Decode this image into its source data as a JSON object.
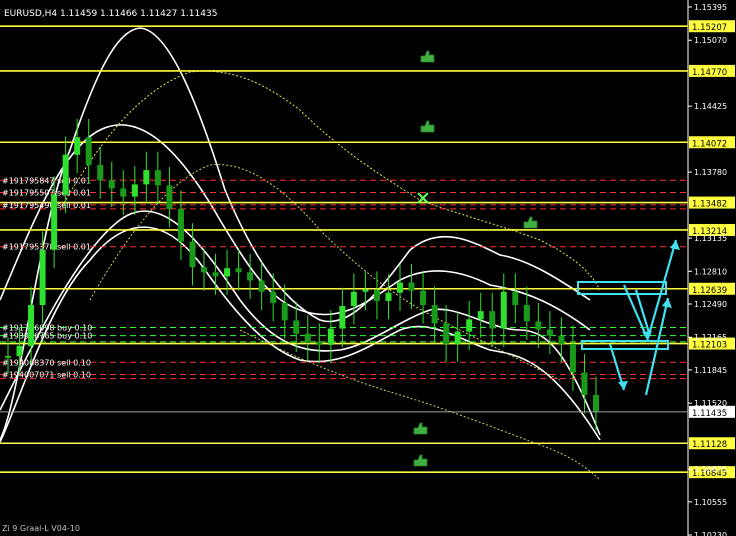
{
  "chart_data": {
    "type": "candlestick",
    "symbol_header": "EURUSD,H4  1.11459 1.11466 1.11427 1.11435",
    "indicator_label": "Zi 9 Graal-L  V04-10",
    "current_price": 1.11435,
    "current_price_label": "1.11435",
    "ylim": [
      1.1025,
      1.15395
    ],
    "y_ticks": [
      {
        "value": 1.15395,
        "label": "1.15395"
      },
      {
        "value": 1.1507,
        "label": "1.15070"
      },
      {
        "value": 1.14425,
        "label": "1.14425"
      },
      {
        "value": 1.1378,
        "label": "1.13780"
      },
      {
        "value": 1.13135,
        "label": "1.13135"
      },
      {
        "value": 1.1281,
        "label": "1.12810"
      },
      {
        "value": 1.1249,
        "label": "1.12490"
      },
      {
        "value": 1.12165,
        "label": "1.12165"
      },
      {
        "value": 1.11845,
        "label": "1.11845"
      },
      {
        "value": 1.1152,
        "label": "1.11520"
      },
      {
        "value": 1.10875,
        "label": "1.10875"
      },
      {
        "value": 1.10555,
        "label": "1.10555"
      },
      {
        "value": 1.1023,
        "label": "1.10230"
      }
    ],
    "level_lines": [
      {
        "value": 1.15207,
        "label": "1.15207"
      },
      {
        "value": 1.1477,
        "label": "1.14770"
      },
      {
        "value": 1.14072,
        "label": "1.14072"
      },
      {
        "value": 1.13482,
        "label": "1.13482"
      },
      {
        "value": 1.13214,
        "label": "1.13214"
      },
      {
        "value": 1.12639,
        "label": "1.12639"
      },
      {
        "value": 1.12103,
        "label": "1.12103"
      },
      {
        "value": 1.11128,
        "label": "1.11128"
      },
      {
        "value": 1.10845,
        "label": "1.10845"
      }
    ],
    "order_lines": [
      {
        "value": 1.137,
        "label": "#191795847 sell 0.01",
        "color": "#ff3030"
      },
      {
        "value": 1.1358,
        "label": "#191795507 sell 0.01",
        "color": "#ff3030"
      },
      {
        "value": 1.1346,
        "label": "#191795490 sell 0.01",
        "color": "#ff3030"
      },
      {
        "value": 1.1342,
        "label": "",
        "color": "#ff3030"
      },
      {
        "value": 1.1305,
        "label": "#191795378 sell 0.01",
        "color": "#ff3030"
      },
      {
        "value": 1.1226,
        "label": "#191756098 buy 0.10",
        "color": "#30ff30"
      },
      {
        "value": 1.1218,
        "label": "#193946765 buy 0.10",
        "color": "#30ff30"
      },
      {
        "value": 1.1212,
        "label": "",
        "color": "#30ff30"
      },
      {
        "value": 1.1192,
        "label": "#194068370 sell 0.10",
        "color": "#ff3030"
      },
      {
        "value": 1.118,
        "label": "#194007071 sell 0.10",
        "color": "#ff3030"
      },
      {
        "value": 1.1176,
        "label": "",
        "color": "#ff3030"
      }
    ],
    "candles_close_path": [
      1.1198,
      1.1208,
      1.1248,
      1.1302,
      1.1356,
      1.1395,
      1.1412,
      1.1385,
      1.137,
      1.1362,
      1.1354,
      1.1366,
      1.138,
      1.1365,
      1.1342,
      1.131,
      1.1285,
      1.128,
      1.1276,
      1.1284,
      1.128,
      1.1272,
      1.1261,
      1.125,
      1.1233,
      1.122,
      1.1212,
      1.1209,
      1.1225,
      1.1247,
      1.1261,
      1.1263,
      1.1252,
      1.126,
      1.127,
      1.1262,
      1.1248,
      1.123,
      1.121,
      1.1222,
      1.1234,
      1.1242,
      1.1225,
      1.1261,
      1.1248,
      1.1232,
      1.1224,
      1.1218,
      1.121,
      1.1182,
      1.116,
      1.11435
    ],
    "series_color": "#30e030",
    "level_line_color": "#ffff40",
    "band_color": "#ffffff",
    "ma_color": "#e8e840",
    "arrow_color": "#40e0f0"
  }
}
